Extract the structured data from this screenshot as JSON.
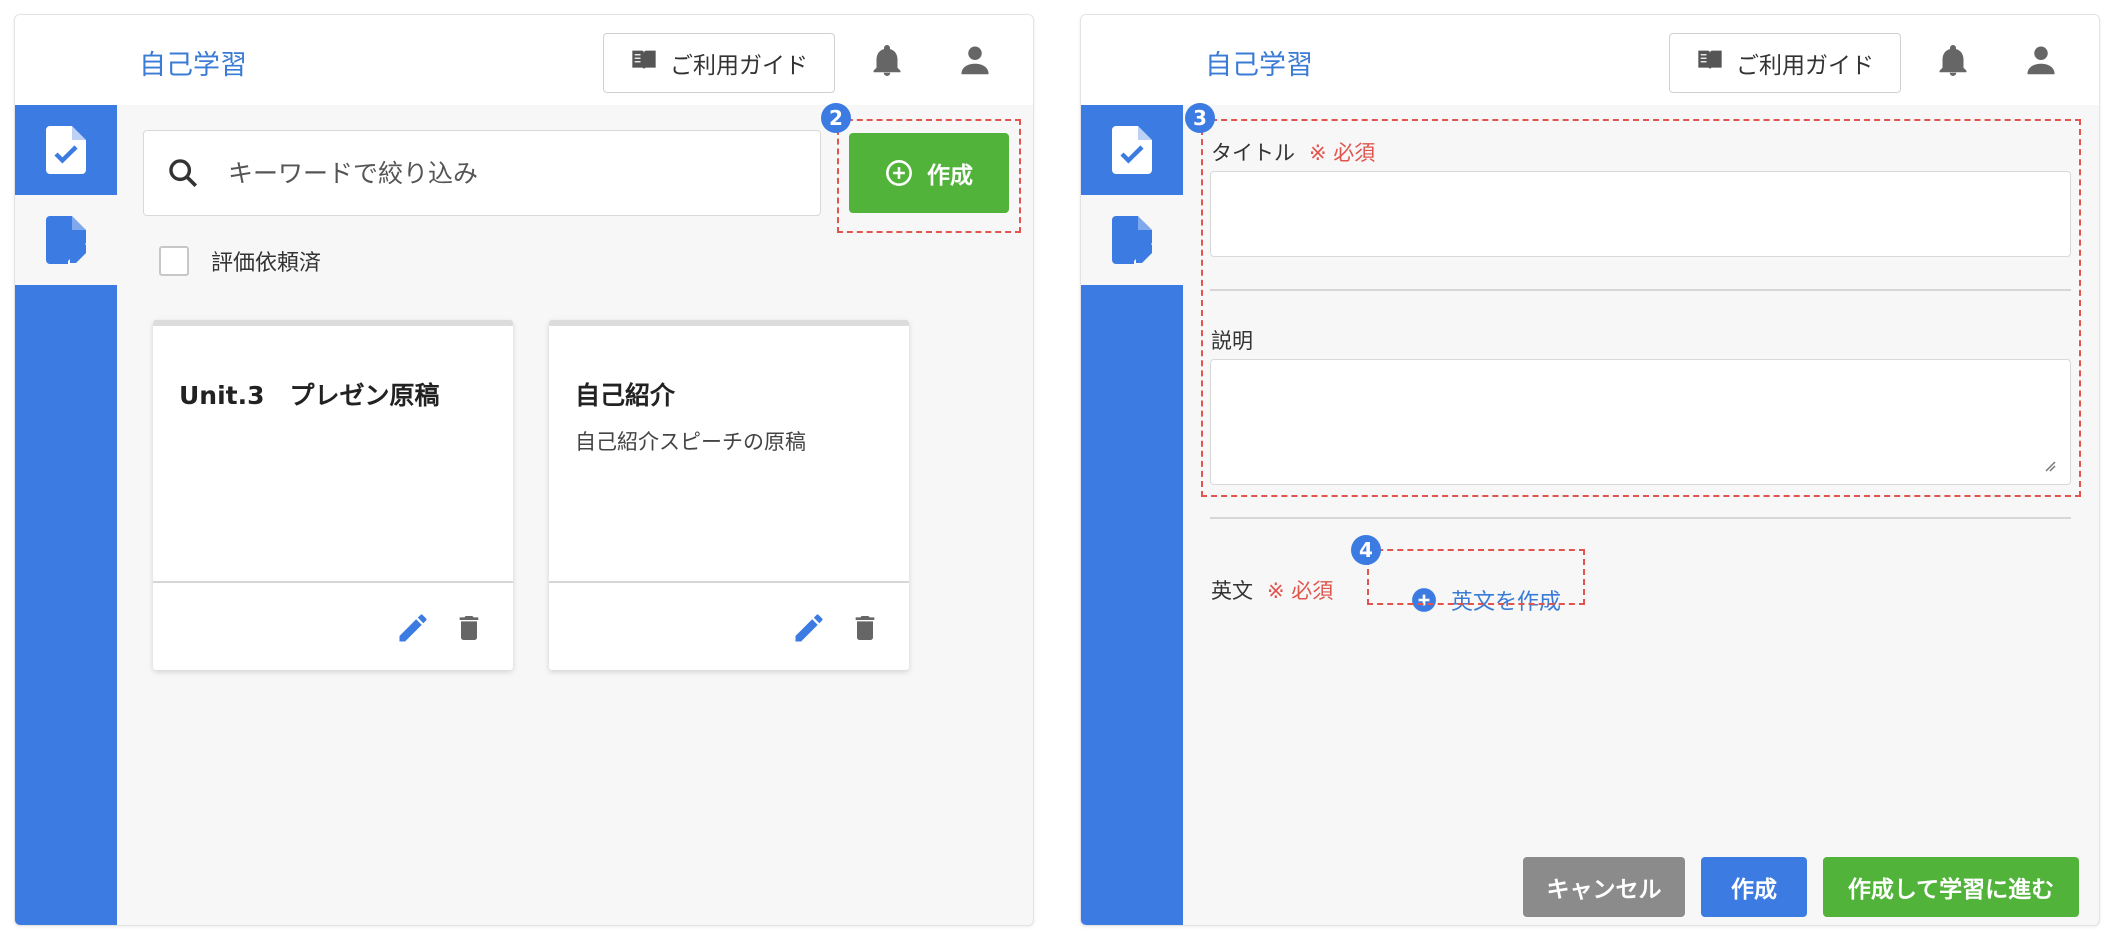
{
  "app": {
    "title": "自己学習",
    "guide_label": "ご利用ガイド"
  },
  "left": {
    "search_placeholder": "キーワードで絞り込み",
    "create_label": "作成",
    "filter_label": "評価依頼済",
    "cards": [
      {
        "title": "Unit.3　プレゼン原稿",
        "description": ""
      },
      {
        "title": "自己紹介",
        "description": "自己紹介スピーチの原稿"
      }
    ]
  },
  "right": {
    "title_label": "タイトル",
    "required_mark": "※ 必須",
    "description_label": "説明",
    "english_label": "英文",
    "english_create_label": "英文を作成",
    "cancel_label": "キャンセル",
    "create_label": "作成",
    "create_and_study_label": "作成して学習に進む",
    "title_value": "",
    "description_value": ""
  },
  "annotations": {
    "step2": "2",
    "step3": "3",
    "step4": "4"
  },
  "colors": {
    "accent_blue": "#3b7be2",
    "green": "#52b33b",
    "gray": "#8b8b8b",
    "required_red": "#e0564e",
    "annotation_dash": "#e0564e"
  },
  "icons": [
    "book-icon",
    "bell-icon",
    "user-icon",
    "file-check-icon",
    "file-edit-icon",
    "search-icon",
    "plus-circle-icon",
    "pencil-icon",
    "trash-icon"
  ]
}
